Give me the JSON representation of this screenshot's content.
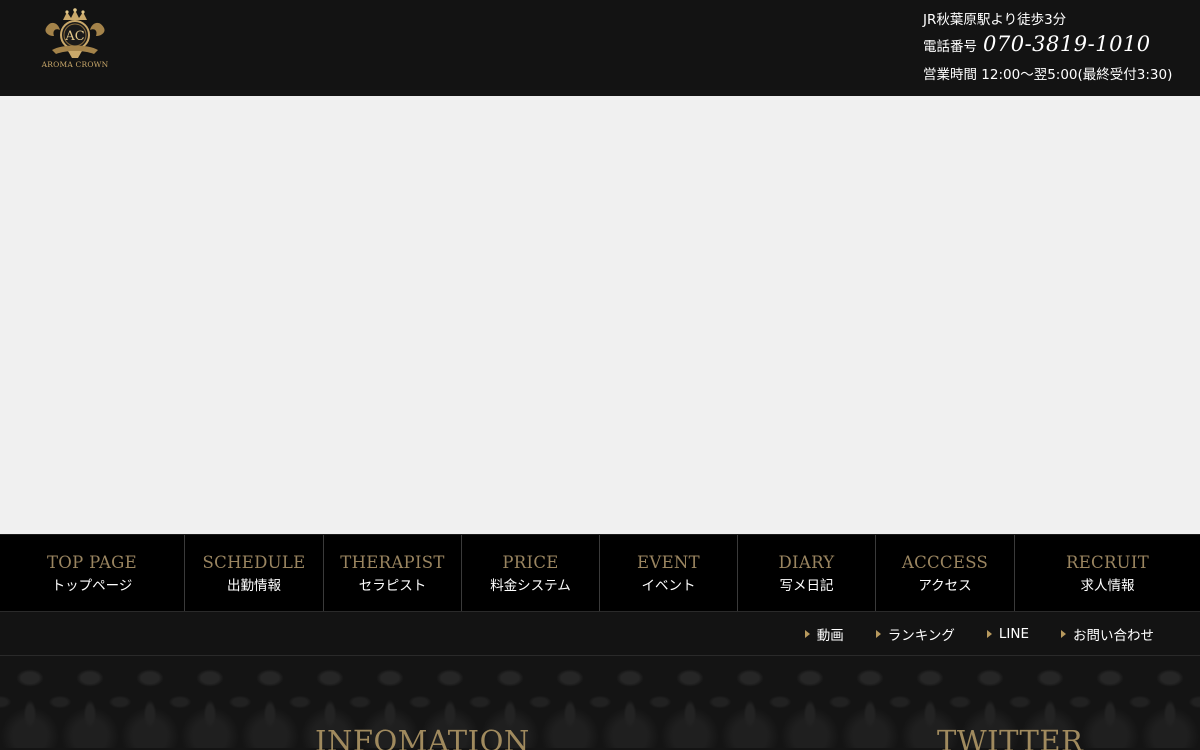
{
  "header": {
    "logo": {
      "monogram": "AC",
      "name": "AROMA CROWN"
    },
    "access": "JR秋葉原駅より徒歩3分",
    "phone_label": "電話番号",
    "phone_number": "070-3819-1010",
    "hours": "営業時間 12:00～翌5:00(最終受付3:30)"
  },
  "nav": {
    "items": [
      {
        "en": "TOP PAGE",
        "ja": "トップページ"
      },
      {
        "en": "SCHEDULE",
        "ja": "出勤情報"
      },
      {
        "en": "THERAPIST",
        "ja": "セラピスト"
      },
      {
        "en": "PRICE",
        "ja": "料金システム"
      },
      {
        "en": "EVENT",
        "ja": "イベント"
      },
      {
        "en": "DIARY",
        "ja": "写メ日記"
      },
      {
        "en": "ACCCESS",
        "ja": "アクセス"
      },
      {
        "en": "RECRUIT",
        "ja": "求人情報"
      }
    ]
  },
  "subnav": {
    "items": [
      {
        "label": "動画"
      },
      {
        "label": "ランキング"
      },
      {
        "label": "LINE"
      },
      {
        "label": "お問い合わせ"
      }
    ]
  },
  "sections": {
    "info_title": "INFOMATION",
    "twitter_title": "TWITTER"
  },
  "colors": {
    "gold": "#9a8560",
    "header_bg": "#131313",
    "hero_bg": "#f0f0f0",
    "nav_bg": "#000000"
  }
}
